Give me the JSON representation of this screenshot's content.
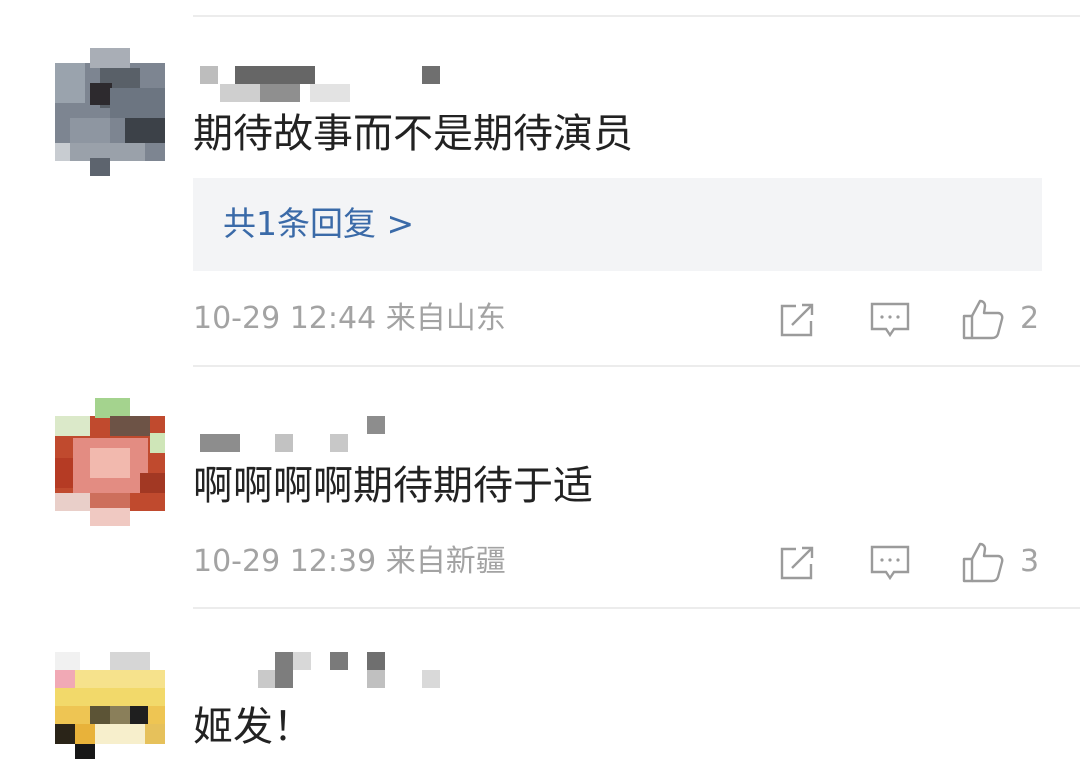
{
  "comments": [
    {
      "text": "期待故事而不是期待演员",
      "reply": "共1条回复 >",
      "time": "10-29 12:44",
      "location": "来自山东",
      "likes": "2",
      "icons": {
        "share": "share-icon",
        "comment": "comment-icon",
        "like": "thumbs-up-icon"
      }
    },
    {
      "text": "啊啊啊啊期待期待于适",
      "time": "10-29 12:39",
      "location": "来自新疆",
      "likes": "3",
      "icons": {
        "share": "share-icon",
        "comment": "comment-icon",
        "like": "thumbs-up-icon"
      }
    },
    {
      "text": "姬发！"
    }
  ],
  "colors": {
    "reply_link": "#3a6aa8",
    "meta_text": "#a3a3a3",
    "reply_background": "#f3f4f6",
    "divider": "#ececec"
  }
}
